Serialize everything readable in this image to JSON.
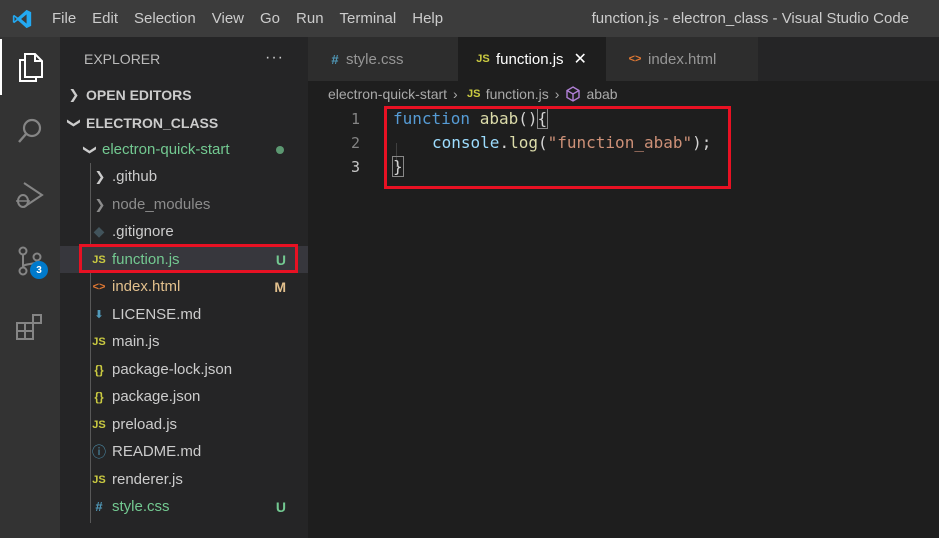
{
  "titlebar": {
    "menu": [
      "File",
      "Edit",
      "Selection",
      "View",
      "Go",
      "Run",
      "Terminal",
      "Help"
    ],
    "window_title": "function.js - electron_class - Visual Studio Code"
  },
  "activity": {
    "source_control_badge": "3"
  },
  "explorer": {
    "header": "EXPLORER",
    "more": "···",
    "open_editors": "OPEN EDITORS",
    "workspace": "ELECTRON_CLASS",
    "folder": "electron-quick-start",
    "items": [
      {
        "name": ".github",
        "status": ""
      },
      {
        "name": "node_modules",
        "status": ""
      },
      {
        "name": ".gitignore",
        "status": ""
      },
      {
        "name": "function.js",
        "status": "U"
      },
      {
        "name": "index.html",
        "status": "M"
      },
      {
        "name": "LICENSE.md",
        "status": ""
      },
      {
        "name": "main.js",
        "status": ""
      },
      {
        "name": "package-lock.json",
        "status": ""
      },
      {
        "name": "package.json",
        "status": ""
      },
      {
        "name": "preload.js",
        "status": ""
      },
      {
        "name": "README.md",
        "status": ""
      },
      {
        "name": "renderer.js",
        "status": ""
      },
      {
        "name": "style.css",
        "status": "U"
      }
    ]
  },
  "tabs": [
    {
      "label": "style.css"
    },
    {
      "label": "function.js"
    },
    {
      "label": "index.html"
    }
  ],
  "breadcrumb": {
    "folder": "electron-quick-start",
    "file": "function.js",
    "symbol": "abab"
  },
  "code": {
    "line_numbers": [
      "1",
      "2",
      "3"
    ],
    "l1_kw": "function",
    "l1_fn": "abab",
    "l1_paren": "()",
    "l1_brace": "{",
    "l2_obj": "console",
    "l2_dot": ".",
    "l2_method": "log",
    "l2_open": "(",
    "l2_str": "\"function_abab\"",
    "l2_close": ");",
    "l3_brace": "}"
  },
  "icons": {
    "js": "JS",
    "html": "<>",
    "json": "{}",
    "css": "#"
  }
}
